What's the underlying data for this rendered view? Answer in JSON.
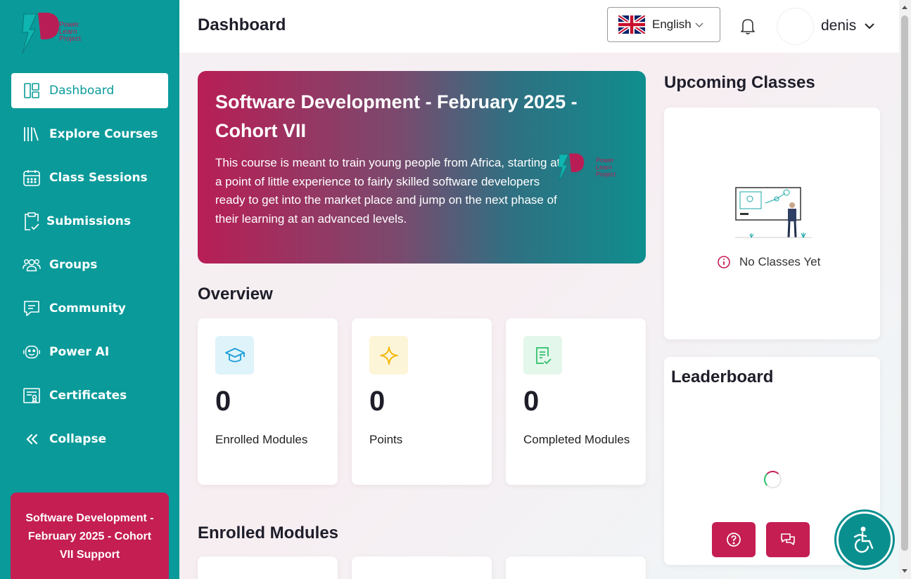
{
  "app": {
    "logo_text_lines": [
      "Power",
      "Learn",
      "Project"
    ]
  },
  "sidebar": {
    "items": [
      {
        "label": "Dashboard",
        "icon": "dashboard-icon",
        "active": true
      },
      {
        "label": "Explore Courses",
        "icon": "books-icon"
      },
      {
        "label": "Class Sessions",
        "icon": "calendar-icon"
      },
      {
        "label": "Submissions",
        "icon": "clipboard-check-icon"
      },
      {
        "label": "Groups",
        "icon": "users-icon"
      },
      {
        "label": "Community",
        "icon": "chat-icon"
      },
      {
        "label": "Power AI",
        "icon": "robot-icon"
      },
      {
        "label": "Certificates",
        "icon": "certificate-icon"
      },
      {
        "label": "Collapse",
        "icon": "chevrons-left-icon"
      }
    ],
    "support_card": "Software Development - February 2025 - Cohort VII Support"
  },
  "header": {
    "title": "Dashboard",
    "language": "English",
    "user_name": "denis"
  },
  "hero": {
    "title": "Software Development - February 2025 - Cohort VII",
    "description": "This course is meant to train young people from Africa, starting at a point of little experience to fairly skilled software developers ready to get into the market place and jump on the next phase of their learning at an advanced levels."
  },
  "overview": {
    "title": "Overview",
    "stats": [
      {
        "value": "0",
        "label": "Enrolled Modules",
        "icon": "graduation-cap-icon",
        "color": "#1d9fd8"
      },
      {
        "value": "0",
        "label": "Points",
        "icon": "sparkle-icon",
        "color": "#f2b600"
      },
      {
        "value": "0",
        "label": "Completed Modules",
        "icon": "checklist-icon",
        "color": "#2bbf6a"
      }
    ]
  },
  "enrolled_modules": {
    "title": "Enrolled Modules"
  },
  "upcoming_classes": {
    "title": "Upcoming Classes",
    "empty_text": "No Classes Yet"
  },
  "leaderboard": {
    "title": "Leaderboard"
  },
  "colors": {
    "brand_teal": "#0a9a9a",
    "brand_crimson": "#c41e52"
  }
}
